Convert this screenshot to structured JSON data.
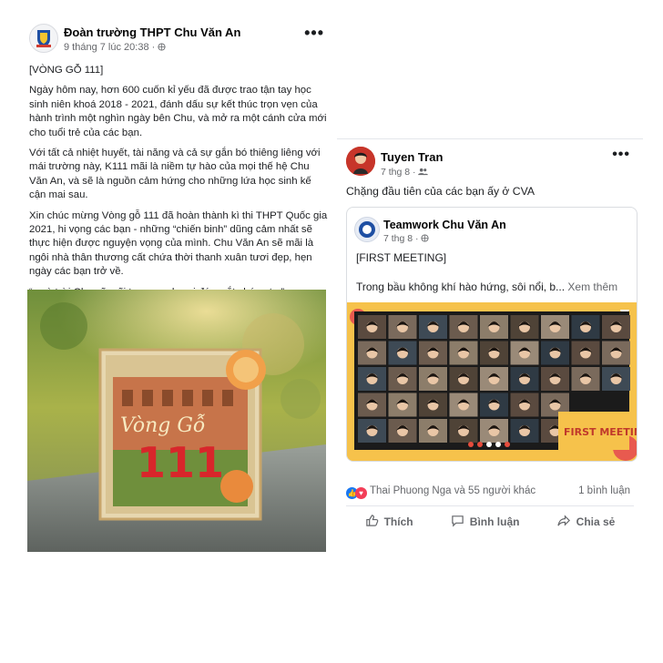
{
  "left_post": {
    "page_name": "Đoàn trường THPT Chu Văn An",
    "time": "9 tháng 7 lúc 20:38 · ",
    "paragraphs": [
      "[VÒNG GỖ 111]",
      "Ngày hôm nay, hơn 600 cuốn kỉ yếu đã được trao tận tay học sinh niên khoá 2018 - 2021, đánh dấu sự kết thúc trọn vẹn của hành trình một nghìn ngày bên Chu, và mở ra một cánh cửa mới cho tuổi trẻ của các bạn.",
      "Với tất cả nhiệt huyết, tài năng và cả sự gắn bó thiêng liêng với mái trường này, K111 mãi là niềm tự hào của mọi thế hệ Chu Văn An, và sẽ là nguồn cảm hứng cho những lứa học sinh kế cận mai sau.",
      "Xin chúc mừng Vòng gỗ 111 đã hoàn thành kì thi THPT Quốc gia 2021, hi vọng các bạn - những “chiến binh” dũng cảm nhất sẽ thực hiện được nguyện vọng của mình. Chu Văn An sẽ mãi là ngôi nhà thân thương cất chứa thời thanh xuân tươi đẹp, hẹn ngày các bạn trở về.",
      "“...và trời Chu sẽ mãi trong xanh nơi đáy mắt chúng ta.”"
    ],
    "book_title": "Vòng Gỗ",
    "book_number": "111"
  },
  "right_post": {
    "author": "Tuyen Tran",
    "time": "7 thg 8 · ",
    "caption": "Chặng đầu tiên của các bạn ấy ở CVA",
    "shared": {
      "page_name": "Teamwork Chu Văn An",
      "time": "7 thg 8 · ",
      "line1": "[FIRST MEETING]",
      "line2": "Trong bầu không khí hào hứng, sôi nổi, b...",
      "see_more": "Xem thêm",
      "image_caption": "FIRST MEETING"
    },
    "reactions_text": "Thai Phuong Nga và 55 người khác",
    "comments_text": "1 bình luận",
    "actions": {
      "like": "Thích",
      "comment": "Bình luận",
      "share": "Chia sẻ"
    }
  },
  "colors": {
    "fb_blue": "#1877f2",
    "heart_red": "#f33e58",
    "meeting_yellow": "#f6c24b"
  }
}
